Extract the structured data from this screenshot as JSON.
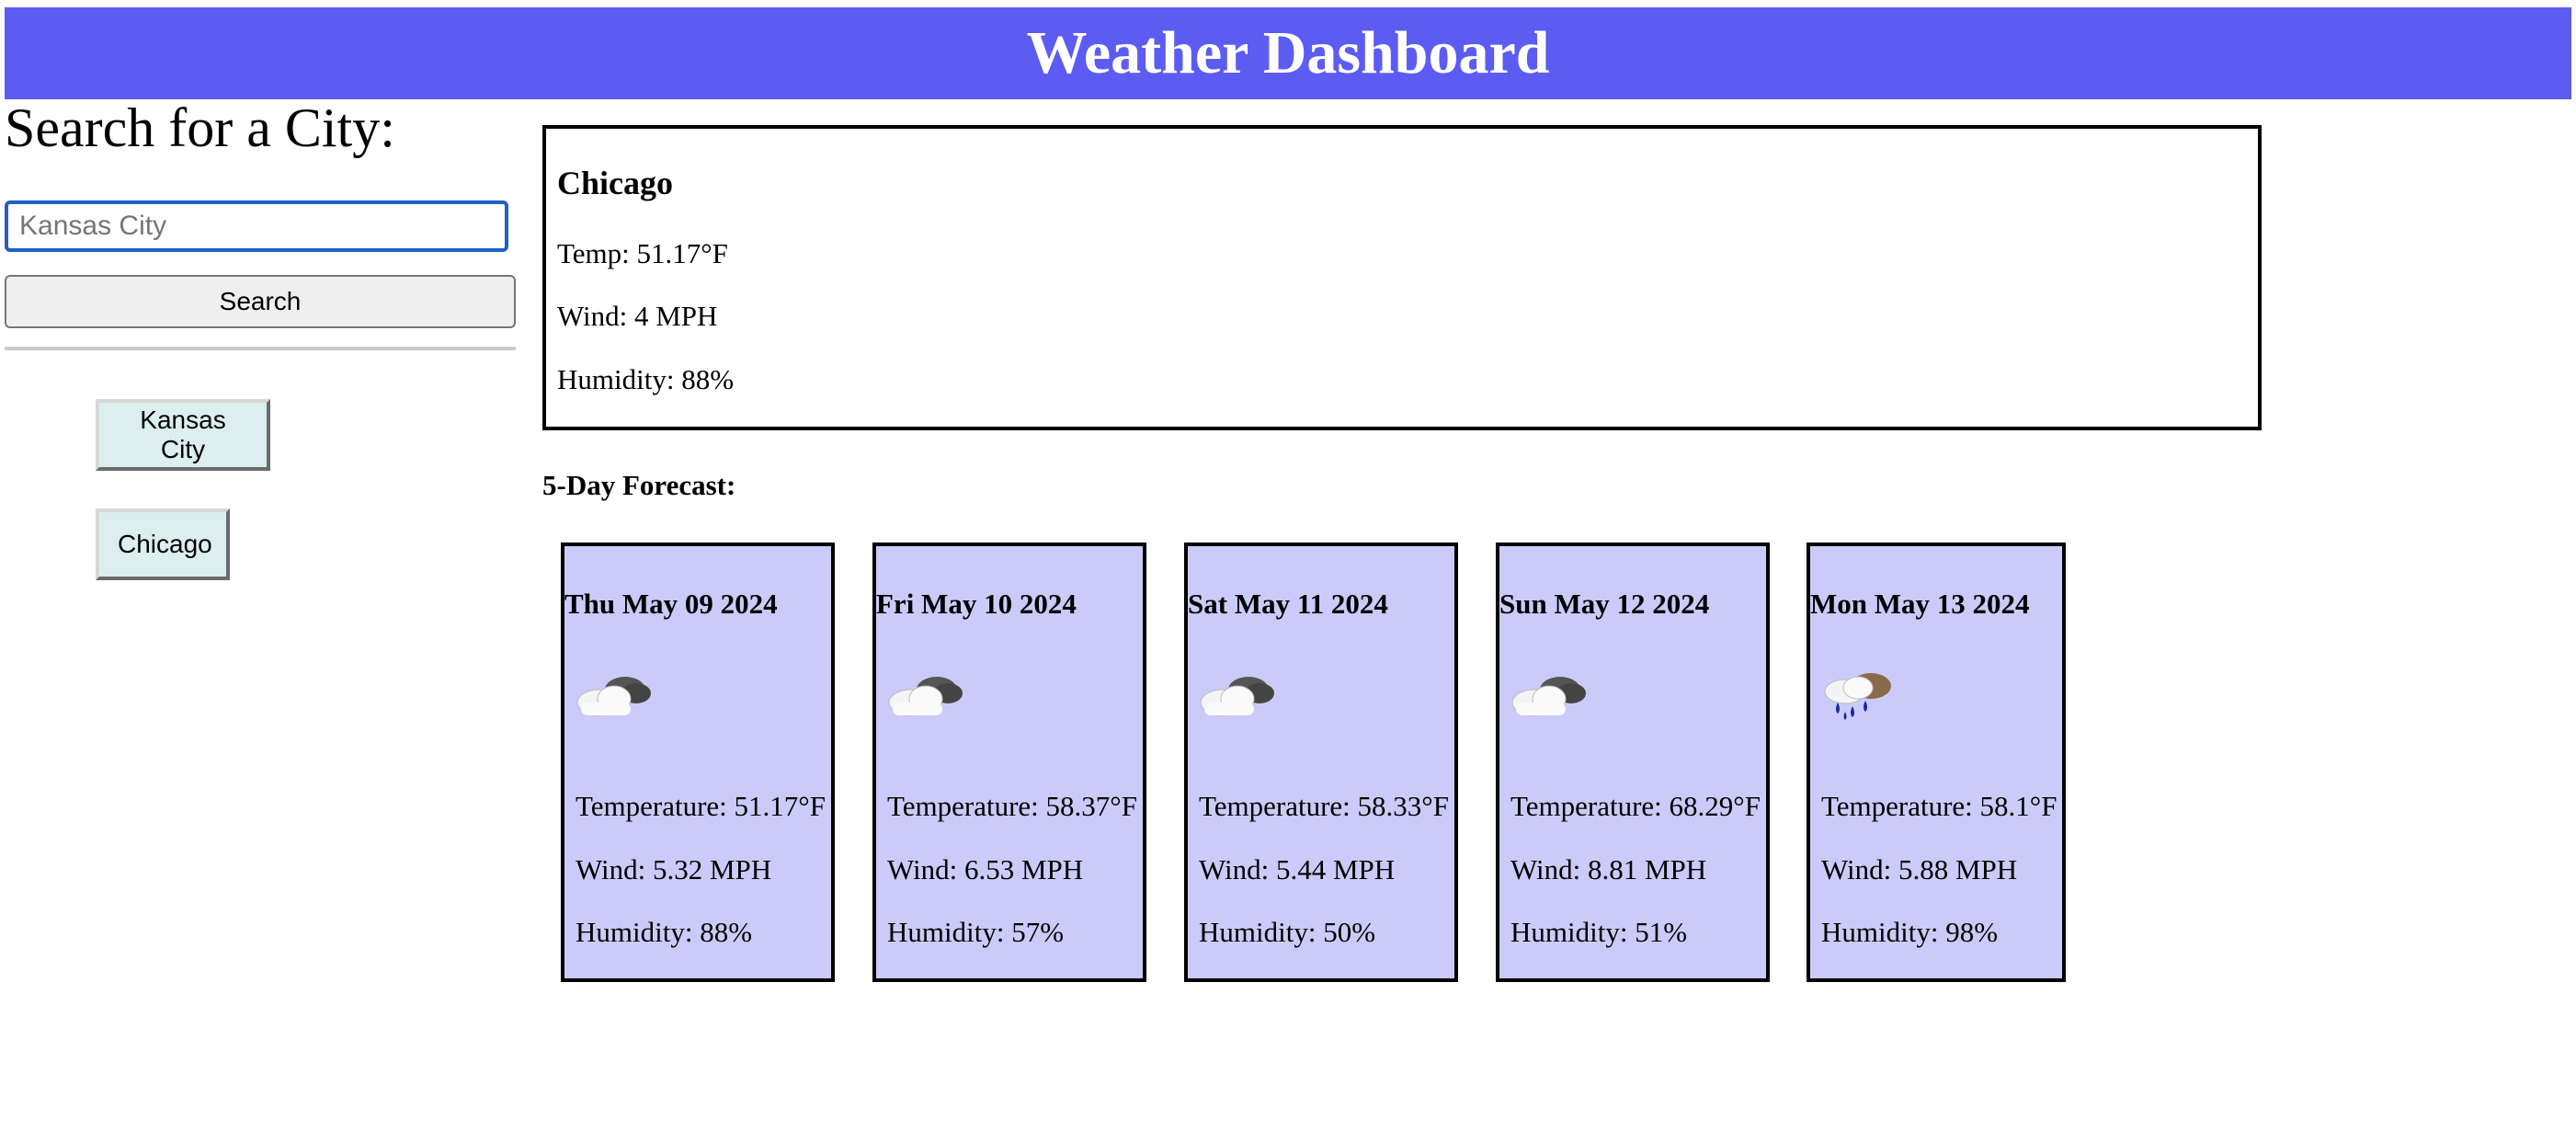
{
  "header": {
    "title": "Weather Dashboard"
  },
  "sidebar": {
    "heading": "Search for a City:",
    "search_placeholder": "Kansas City",
    "search_button": "Search",
    "history": [
      "Kansas City",
      "Chicago"
    ]
  },
  "current": {
    "city": "Chicago",
    "temp": "Temp: 51.17°F",
    "wind": "Wind: 4 MPH",
    "humidity": "Humidity: 88%"
  },
  "forecast": {
    "title": "5-Day Forecast:",
    "days": [
      {
        "date": "Thu May 09 2024",
        "icon": "cloudy-icon",
        "temp": "Temperature: 51.17°F",
        "wind": "Wind: 5.32 MPH",
        "humidity": "Humidity: 88%"
      },
      {
        "date": "Fri May 10 2024",
        "icon": "cloudy-icon",
        "temp": "Temperature: 58.37°F",
        "wind": "Wind: 6.53 MPH",
        "humidity": "Humidity: 57%"
      },
      {
        "date": "Sat May 11 2024",
        "icon": "cloudy-icon",
        "temp": "Temperature: 58.33°F",
        "wind": "Wind: 5.44 MPH",
        "humidity": "Humidity: 50%"
      },
      {
        "date": "Sun May 12 2024",
        "icon": "cloudy-icon",
        "temp": "Temperature: 68.29°F",
        "wind": "Wind: 8.81 MPH",
        "humidity": "Humidity: 51%"
      },
      {
        "date": "Mon May 13 2024",
        "icon": "rain-icon",
        "temp": "Temperature: 58.1°F",
        "wind": "Wind: 5.88 MPH",
        "humidity": "Humidity: 98%"
      }
    ]
  },
  "colors": {
    "header_bg": "#5d5cf2",
    "card_bg": "#cbcbfa",
    "history_bg": "#dceeee"
  }
}
